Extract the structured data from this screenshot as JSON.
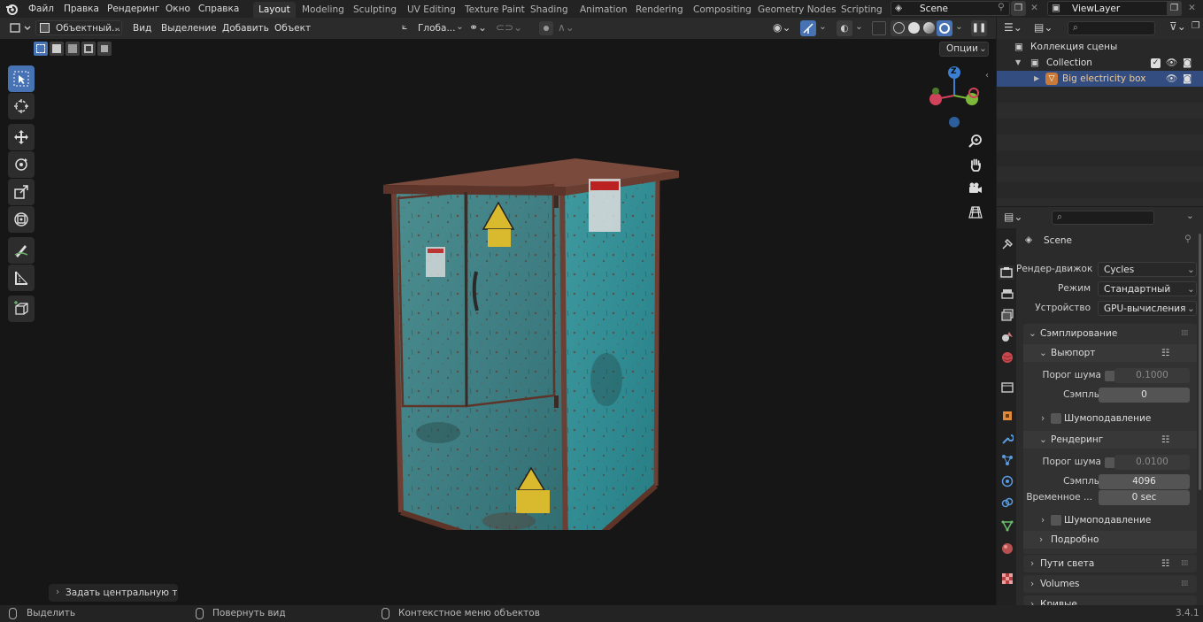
{
  "menus": [
    "Файл",
    "Правка",
    "Рендеринг",
    "Окно",
    "Справка"
  ],
  "workspaces": [
    "Layout",
    "Modeling",
    "Sculpting",
    "UV Editing",
    "Texture Paint",
    "Shading",
    "Animation",
    "Rendering",
    "Compositing",
    "Geometry Nodes",
    "Scripting"
  ],
  "active_workspace": "Layout",
  "scene_name": "Scene",
  "view_layer": "ViewLayer",
  "viewport_header": {
    "mode": "Объектный...",
    "menus": [
      "Вид",
      "Выделение",
      "Добавить",
      "Объект"
    ],
    "orientation": "Глоба...",
    "options_label": "Опции"
  },
  "gizmo": {
    "z_label": "Z"
  },
  "last_operator": "Задать центральную точк",
  "outliner": {
    "scene_collection": "Коллекция сцены",
    "collection": "Collection",
    "object": "Big electricity box"
  },
  "properties": {
    "title": "Scene",
    "render_engine_label": "Рендер-движок",
    "render_engine": "Cycles",
    "mode_label": "Режим",
    "mode": "Стандартный",
    "device_label": "Устройство",
    "device": "GPU-вычисления",
    "sampling": "Сэмплирование",
    "viewport": "Выюпорт",
    "noise_threshold_label": "Порог шума",
    "viewport_noise_threshold": "0.1000",
    "samples_label": "Сэмплы",
    "viewport_samples": "0",
    "denoise": "Шумоподавление",
    "render": "Рендеринг",
    "render_noise_threshold": "0.0100",
    "render_samples": "4096",
    "time_limit_label": "Временное ...",
    "time_limit": "0 sec",
    "advanced": "Подробно",
    "light_paths": "Пути света",
    "volumes": "Volumes",
    "curves": "Кривые"
  },
  "status": {
    "select": "Выделить",
    "rotate": "Повернуть вид",
    "context": "Контекстное меню объектов",
    "version": "3.4.1"
  },
  "colors": {
    "accent": "#4772b3",
    "box_teal": "#3c8a8a",
    "rust": "#6b3f33"
  }
}
